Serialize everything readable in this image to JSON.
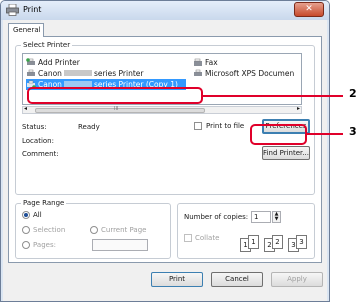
{
  "window": {
    "title": "Print",
    "close_glyph": "✕"
  },
  "tabs": [
    {
      "label": "General"
    }
  ],
  "select_printer": {
    "label": "Select Printer",
    "printers": [
      {
        "name": "Add Printer",
        "icon": "add-printer-icon"
      },
      {
        "name_prefix": "Canon",
        "name_suffix": "series Printer",
        "icon": "printer-icon"
      },
      {
        "name_prefix": "Canon",
        "name_suffix": "series Printer (Copy 1)",
        "icon": "printer-icon",
        "selected": true
      },
      {
        "name": "Fax",
        "icon": "fax-icon"
      },
      {
        "name": "Microsoft XPS Documen",
        "icon": "printer-icon"
      }
    ],
    "scroll_mid": "III"
  },
  "status": {
    "status_label": "Status:",
    "status_value": "Ready",
    "location_label": "Location:",
    "comment_label": "Comment:",
    "print_to_file": "Print to file",
    "preferences": "Preferences",
    "find_printer": "Find Printer..."
  },
  "page_range": {
    "label": "Page Range",
    "all": "All",
    "selection": "Selection",
    "current_page": "Current Page",
    "pages": "Pages:"
  },
  "copies": {
    "label": "Number of copies:",
    "value": "1",
    "collate": "Collate",
    "collate_pages": [
      "1",
      "1",
      "2",
      "2",
      "3",
      "3"
    ]
  },
  "buttons": {
    "print": "Print",
    "cancel": "Cancel",
    "apply": "Apply"
  },
  "callouts": [
    {
      "number": "2"
    },
    {
      "number": "3"
    }
  ],
  "colors": {
    "callout": "#e0002a",
    "selection": "#3399ff"
  }
}
